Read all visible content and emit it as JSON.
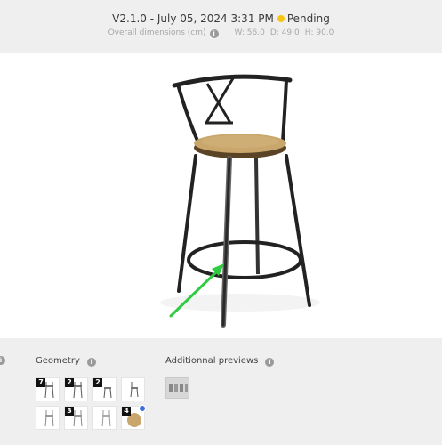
{
  "header": {
    "version_date": "V2.1.0 - July 05, 2024 3:31 PM",
    "status": "Pending",
    "status_color": "#f5c518",
    "dims_label": "Overall dimensions (cm)",
    "width": "W: 56.0",
    "depth": "D: 49.0",
    "height": "H: 90.0"
  },
  "geometry": {
    "label": "Geometry",
    "thumbnails": [
      {
        "badge": "7",
        "icon": "stool-thumbnail"
      },
      {
        "badge": "2",
        "icon": "stool-thumbnail"
      },
      {
        "badge": "2",
        "icon": "stool-thumbnail"
      },
      {
        "badge": "",
        "icon": "stool-thumbnail"
      },
      {
        "badge": "",
        "icon": "stool-thumbnail"
      },
      {
        "badge": "3",
        "icon": "stool-thumbnail"
      },
      {
        "badge": "",
        "icon": "stool-thumbnail"
      },
      {
        "badge": "4",
        "icon": "seat-thumbnail"
      }
    ]
  },
  "previews": {
    "label": "Additionnal previews"
  },
  "colors": {
    "accent_arrow": "#2ecc40",
    "selected_dot": "#3b6fe0"
  }
}
